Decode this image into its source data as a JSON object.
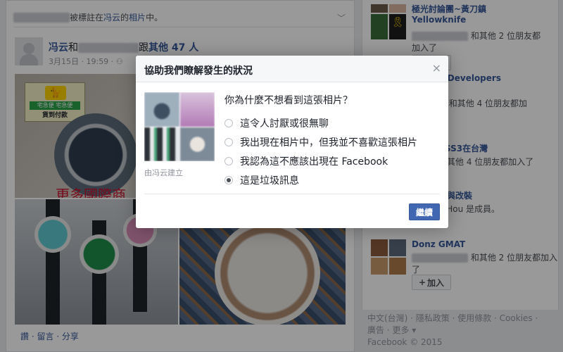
{
  "post": {
    "notice_suffix": "被標註在",
    "notice_owner": "冯云",
    "notice_owner_suffix": "的",
    "notice_photo": "相片",
    "notice_end": "中。",
    "author": "冯云",
    "author_and": "和",
    "author_with": "跟",
    "others": "其他 47 人",
    "date": "3月15日 · 19:59 · ",
    "photo_banner_text": "更多國際商",
    "logo_cat": "🐈",
    "logo_green": "宅急便 宅急便",
    "logo_red": "貨到付款",
    "actions": "讚 · 留言 · 分享"
  },
  "right": {
    "groups": [
      {
        "name_line1": "極光討論團~黃刀鎮",
        "name_line2": "Yellowknife",
        "meta": "和其他 2 位朋友都",
        "action": "加入了",
        "join_label": "加入",
        "thumb_colors": [
          "#6d5a48",
          "#d9b5a0",
          "#3a6b3a",
          "#f2c800"
        ]
      },
      {
        "name_line1": "d Developers",
        "meta": "iu 和其他 4 位朋友都加",
        "thumb_colors": []
      },
      {
        "name_line1": "CSS3在台灣",
        "meta": "和其他 4 位朋友都加入了",
        "thumb_colors": []
      },
      {
        "name_line1": "創與改裝",
        "meta": "e Hou 是成員。",
        "thumb_colors": []
      },
      {
        "name_line1": "Donz GMAT",
        "meta": "和其他 2 位朋友都加入",
        "action": "了",
        "join_label": "加入",
        "thumb_colors": [
          "#8a5a3c",
          "#5b6a7c",
          "#c79a6a",
          "#b07a4a"
        ]
      }
    ],
    "footer_line1": "中文(台灣) · 隱私政策 · 使用條款 · Cookies ·",
    "footer_line2": "廣告 · 更多 ▾",
    "footer_line3": "Facebook © 2015"
  },
  "dialog": {
    "title": "協助我們瞭解發生的狀況",
    "close_icon": "×",
    "question": "你為什麼不想看到這張相片？",
    "options": [
      "這令人討厭或很無聊",
      "我出現在相片中，但我並不喜歡這張相片",
      "我認為這不應該出現在 Facebook",
      "這是垃圾訊息"
    ],
    "selected_index": 3,
    "creator": "由冯云建立",
    "continue_label": "繼續",
    "thumb_colors": [
      "#7f97a6",
      "#c6a7c8",
      "#3a3f45",
      "#9aa4ae"
    ]
  },
  "colors": {
    "accent": "#4267b2",
    "link": "#365899",
    "overlay": "rgba(0,0,0,0.40)"
  }
}
